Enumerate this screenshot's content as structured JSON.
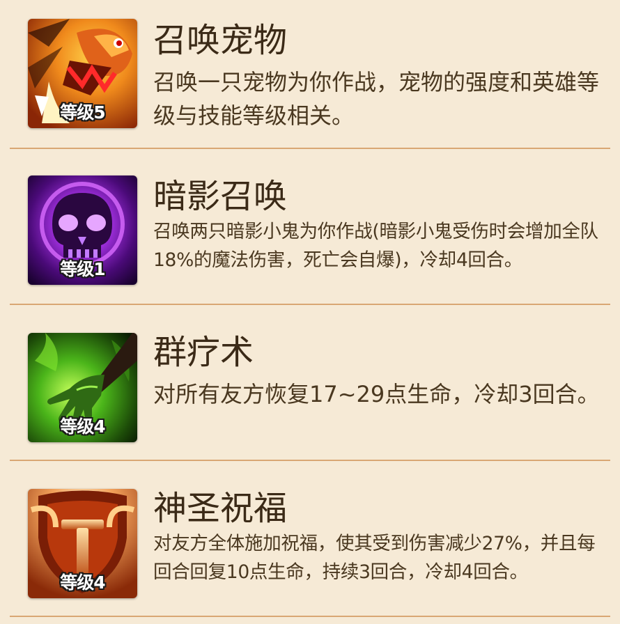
{
  "skills": [
    {
      "name": "召唤宠物",
      "level": "等级5",
      "icon": "fire-beast-icon",
      "description": "召唤一只宠物为你作战，宠物的强度和英雄等级与技能等级相关。"
    },
    {
      "name": "暗影召唤",
      "level": "等级1",
      "icon": "shadow-skull-icon",
      "description": "召唤两只暗影小鬼为你作战(暗影小鬼受伤时会增加全队18%的魔法伤害，死亡会自爆)，冷却4回合。"
    },
    {
      "name": "群疗术",
      "level": "等级4",
      "icon": "healing-hand-icon",
      "description": "对所有友方恢复17~29点生命，冷却3回合。"
    },
    {
      "name": "神圣祝福",
      "level": "等级4",
      "icon": "holy-shield-icon",
      "description": "对友方全体施加祝福，使其受到伤害减少27%，并且每回合回复10点生命，持续3回合，冷却4回合。"
    }
  ],
  "colors": {
    "background": "#f6ead6",
    "divider": "#d9a774",
    "title_text": "#3b2a17",
    "body_text": "#4a3820"
  }
}
